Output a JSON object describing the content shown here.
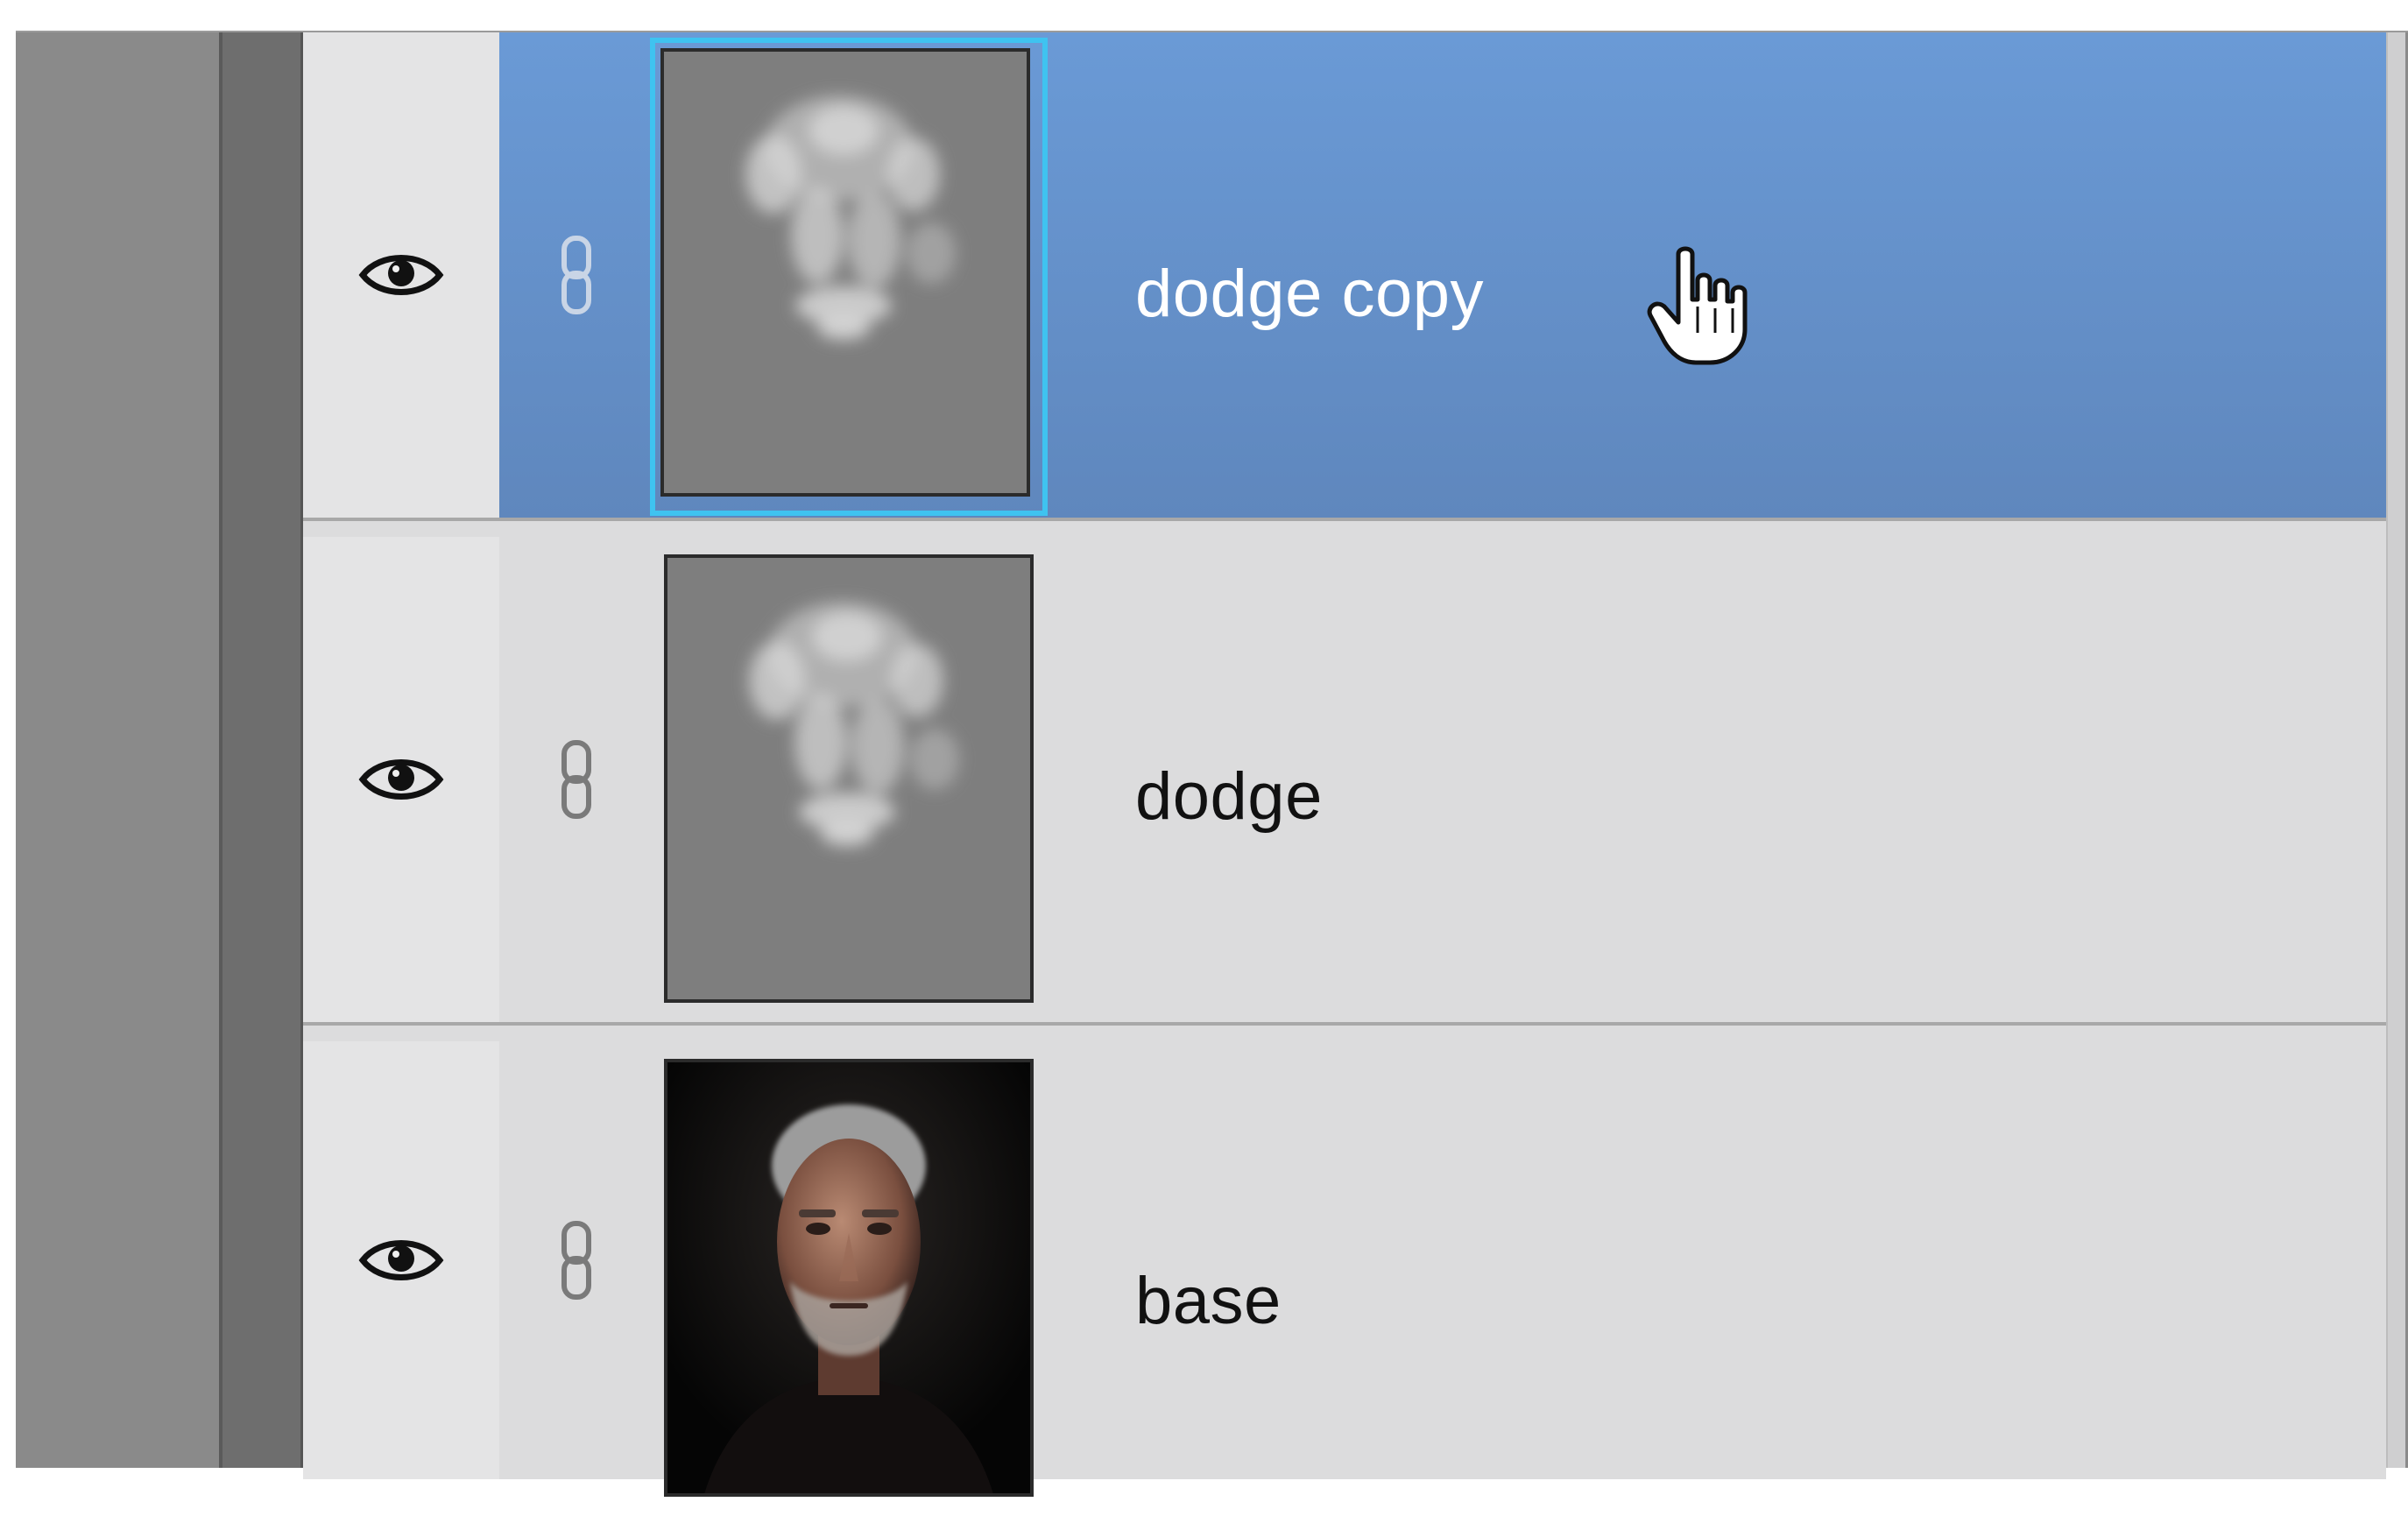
{
  "layers_panel": {
    "layers": [
      {
        "name": "dodge copy",
        "visible": true,
        "selected": true,
        "thumbnail": "dodge-mask-thumbnail"
      },
      {
        "name": "dodge",
        "visible": true,
        "selected": false,
        "thumbnail": "dodge-mask-thumbnail"
      },
      {
        "name": "base",
        "visible": true,
        "selected": false,
        "thumbnail": "portrait-photo-thumbnail"
      }
    ],
    "icons": {
      "visibility": "eye-icon",
      "link": "chain-link-icon",
      "cursor": "hand-pointer-cursor"
    },
    "colors": {
      "selection_top": "#6a9ad6",
      "selection_bottom": "#5f87bd",
      "thumbnail_highlight": "#3fc3f0",
      "row_background": "#dcdcdd"
    }
  }
}
